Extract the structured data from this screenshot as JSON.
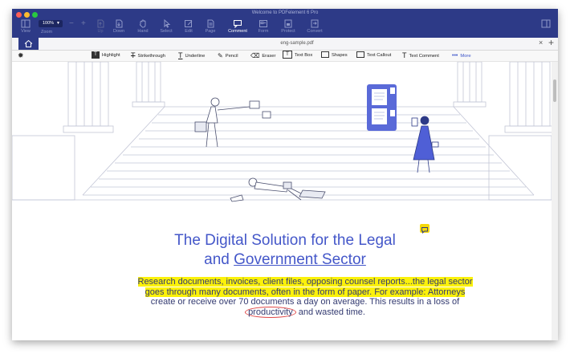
{
  "window": {
    "title": "Welcome to PDFelement 6 Pro"
  },
  "toolbar": {
    "view_label": "View",
    "zoom_value": "100%",
    "zoom_label": "Zoom",
    "up_label": "Up",
    "down_label": "Down",
    "hand_label": "Hand",
    "select_label": "Select",
    "edit_label": "Edit",
    "page_label": "Page",
    "comment_label": "Comment",
    "form_label": "Form",
    "protect_label": "Protect",
    "convert_label": "Convert",
    "active": "Comment"
  },
  "tabs": {
    "document": "eng-sample.pdf"
  },
  "comment_tools": {
    "highlight": "Highlight",
    "strikethrough": "Strikethrough",
    "underline": "Underline",
    "pencil": "Pencil",
    "eraser": "Eraser",
    "textbox": "Text Box",
    "shapes": "Shapes",
    "text_callout": "Text Callout",
    "text_comment": "Text Comment",
    "more": "More"
  },
  "content": {
    "heading_line1": "The Digital Solution for the Legal",
    "heading_line2_prefix": "and",
    "heading_line2_link": "Government Sector",
    "p_line1": "Research documents, invoices, client files, opposing counsel reports...the legal sector",
    "p_line2": "goes through many documents, often in the form of paper. For example: Attorneys",
    "p_line3": "create or receive over 70 documents a day on average. This results in a loss of",
    "p_line4_circled": "productivity",
    "p_line4_rest": " and wasted time."
  },
  "colors": {
    "toolbar_bg": "#2d3a87",
    "accent": "#4457c9",
    "highlight": "#fbf10a",
    "circle_mark": "#e04848"
  }
}
